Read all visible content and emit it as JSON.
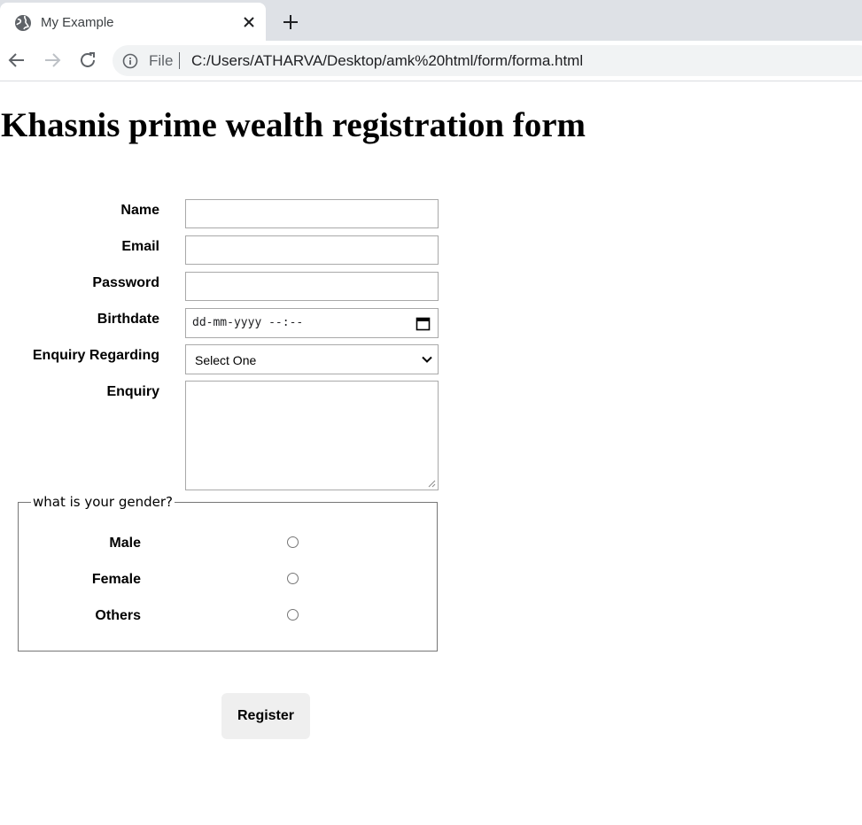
{
  "browser": {
    "tab": {
      "title": "My Example",
      "favicon": "globe-icon",
      "close": "close-icon"
    },
    "new_tab": "plus-icon",
    "nav": {
      "back": "back-arrow-icon",
      "forward": "forward-arrow-icon",
      "reload": "reload-icon"
    },
    "omnibox": {
      "info": "info-icon",
      "scheme_label": "File",
      "url": "C:/Users/ATHARVA/Desktop/amk%20html/form/forma.html"
    }
  },
  "page": {
    "title": "Khasnis prime wealth registration form",
    "form": {
      "name_label": "Name",
      "name_value": "",
      "email_label": "Email",
      "email_value": "",
      "password_label": "Password",
      "password_value": "",
      "birthdate_label": "Birthdate",
      "birthdate_placeholder": "dd-mm-yyyy --:--",
      "enquiry_regarding_label": "Enquiry Regarding",
      "enquiry_regarding_selected": "Select One",
      "enquiry_label": "Enquiry",
      "enquiry_value": ""
    },
    "gender": {
      "legend": "what is your gender?",
      "options": [
        {
          "label": "Male",
          "checked": false
        },
        {
          "label": "Female",
          "checked": false
        },
        {
          "label": "Others",
          "checked": false
        }
      ]
    },
    "register_label": "Register"
  },
  "colors": {
    "tabstrip": "#dee1e6",
    "omnibox": "#f1f3f4",
    "field_border": "#a9a9a9",
    "button_bg": "#efefef"
  }
}
